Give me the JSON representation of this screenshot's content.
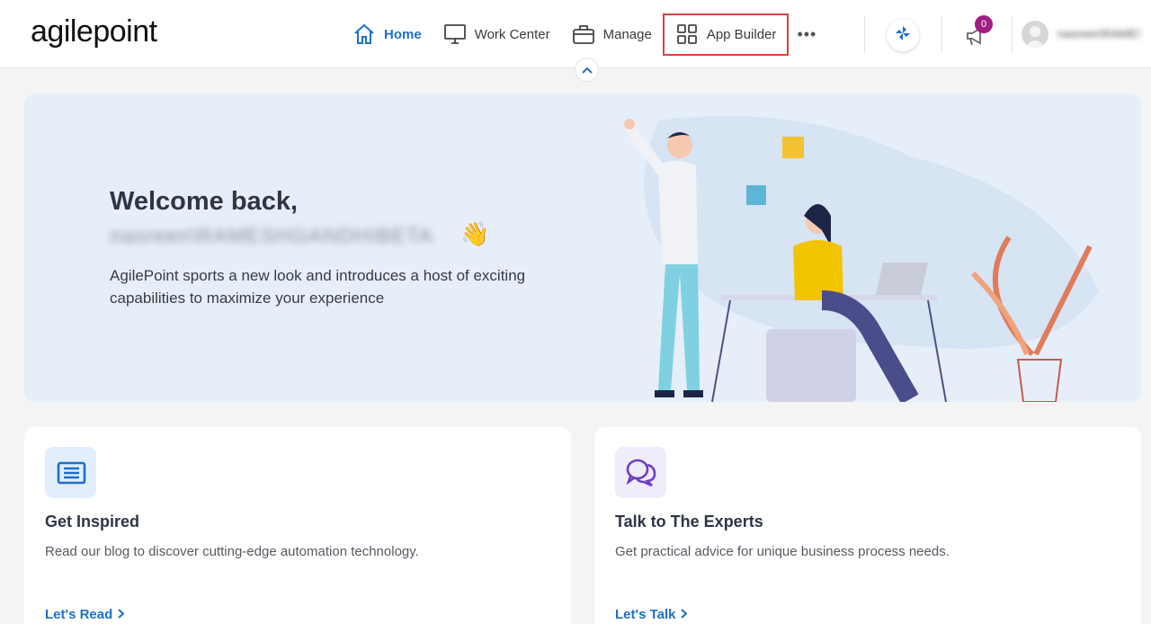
{
  "header": {
    "logo": "agilepoint",
    "nav": [
      {
        "label": "Home",
        "icon": "home-icon"
      },
      {
        "label": "Work Center",
        "icon": "monitor-icon"
      },
      {
        "label": "Manage",
        "icon": "briefcase-icon"
      },
      {
        "label": "App Builder",
        "icon": "grid-icon"
      }
    ],
    "more": "•••",
    "notification_count": "0",
    "username": "nasreen\\RAMESHGANDH..."
  },
  "banner": {
    "greeting": "Welcome back,",
    "user": "nasreen\\RAMESHGANDHIBETA",
    "emoji": "👋",
    "intro": "AgilePoint sports a new look and introduces a host of exciting capabilities to maximize your experience"
  },
  "cards": [
    {
      "title": "Get Inspired",
      "desc": "Read our blog to discover cutting-edge automation technology.",
      "link": "Let's Read",
      "icon": "newspaper-icon",
      "icon_bg": "#e2eefb",
      "icon_color": "#1f6fc6"
    },
    {
      "title": "Talk to The Experts",
      "desc": "Get practical advice for unique business process needs.",
      "link": "Let's Talk",
      "icon": "chat-bubbles-icon",
      "icon_bg": "#f1ecfb",
      "icon_color": "#6b3fc6"
    }
  ],
  "colors": {
    "accent": "#1f6fc6",
    "highlight": "#d9423c",
    "badge": "#a01e84"
  }
}
